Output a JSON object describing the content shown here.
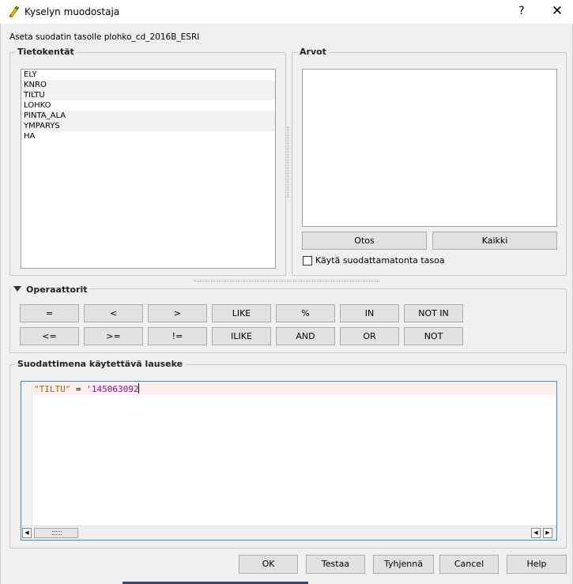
{
  "window": {
    "title": "Kyselyn muodostaja",
    "help_label": "?",
    "close_label": "✕"
  },
  "layer_label": "Aseta suodatin tasolle plohko_cd_2016B_ESRI",
  "fields": {
    "title": "Tietokentät",
    "items": [
      "ELY",
      "KNRO",
      "TILTU",
      "LOHKO",
      "PINTA_ALA",
      "YMPARYS",
      "HA"
    ]
  },
  "values": {
    "title": "Arvot",
    "sample_label": "Otos",
    "all_label": "Kaikki",
    "use_unfiltered_label": "Käytä suodattamatonta tasoa",
    "use_unfiltered_checked": false
  },
  "operators": {
    "title": "Operaattorit",
    "row1": [
      "=",
      "<",
      ">",
      "LIKE",
      "%",
      "IN",
      "NOT IN"
    ],
    "row2": [
      "<=",
      ">=",
      "!=",
      "ILIKE",
      "AND",
      "OR",
      "NOT"
    ]
  },
  "expression": {
    "title": "Suodattimena käytettävä lauseke",
    "field": "\"TILTU\"",
    "op": " = ",
    "value": "'145063092"
  },
  "buttons": {
    "ok": "OK",
    "test": "Testaa",
    "clear": "Tyhjennä",
    "cancel": "Cancel",
    "help": "Help"
  },
  "colors": {
    "accent_border": "#3c8bd6",
    "token_field": "#a06a00",
    "token_string": "#8a0f8f",
    "current_line": "#fdeeee"
  }
}
